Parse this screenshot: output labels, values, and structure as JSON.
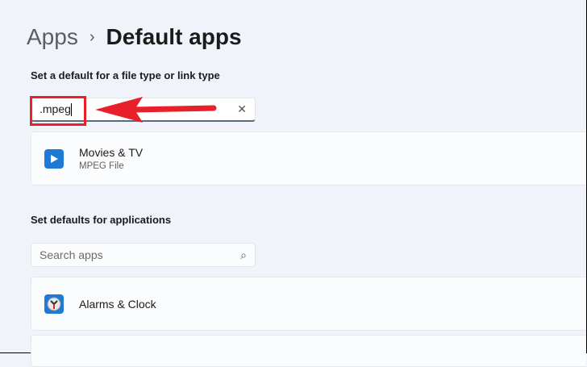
{
  "breadcrumb": {
    "parent": "Apps",
    "separator": "›",
    "current": "Default apps"
  },
  "filetype_section": {
    "label": "Set a default for a file type or link type",
    "search_value": ".mpeg",
    "clear_icon": "✕",
    "result": {
      "app": "Movies & TV",
      "type": "MPEG File"
    }
  },
  "apps_section": {
    "label": "Set defaults for applications",
    "search_placeholder": "Search apps",
    "search_icon": "⌕",
    "apps": [
      {
        "name": "Alarms & Clock"
      }
    ]
  },
  "annotation": {
    "color": "#e8202a"
  }
}
